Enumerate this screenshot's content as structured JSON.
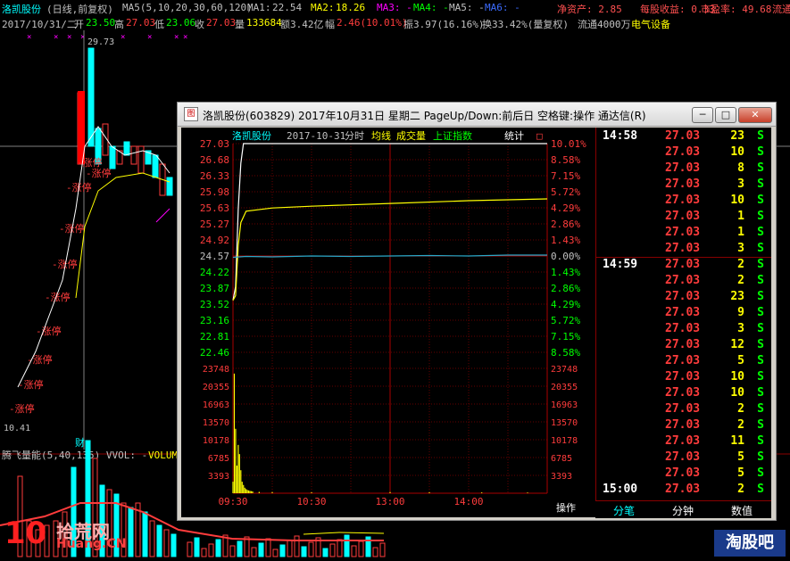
{
  "header": {
    "stock_name": "洛凯股份",
    "period": "(日线,前复权)",
    "ma_params": "MA5(5,10,20,30,60,120)",
    "ma1_label": "MA1:",
    "ma1_value": "22.54",
    "ma2_label": "MA2:",
    "ma2_value": "18.26",
    "ma3_label": "MA3: -",
    "ma4_label": "MA4: -",
    "ma5_label": "MA5: -",
    "ma6_label": "MA6: -",
    "net_asset": "净资产: 2.85",
    "eps": "每股收益: 0.33",
    "pe": "市盈率: 49.68",
    "liquidity": "流通"
  },
  "row2": {
    "date": "2017/10/31/二",
    "open_label": "开",
    "open": "23.50",
    "high_label": "高",
    "high": "27.03",
    "low_label": "低",
    "low": "23.06",
    "close_label": "收",
    "close": "27.03",
    "volume_label": "量",
    "volume": "133684",
    "amount": "额3.42亿",
    "change_label": "幅",
    "change": "2.46(10.01%)",
    "amplitude": "振3.97(16.16%)",
    "turnover": "换33.42%(量复权)",
    "float": "流通4000万",
    "industry": "电气设备"
  },
  "kline": {
    "high_marker": "29.73",
    "low_marker": "10.41",
    "limit_up_text": "涨停",
    "finance_marker": "财",
    "indicator_label": "腾飞量能(5,40,135) VVOL: -",
    "indicator_vol_label": "VOLUM"
  },
  "window": {
    "title": "洛凯股份(603829) 2017年10月31日 星期二 PageUp/Down:前后日 空格键:操作 通达信(R)",
    "btn_min": "─",
    "btn_max": "□",
    "btn_close": "✕",
    "chart_title": "洛凯股份",
    "chart_date": "2017-10-31",
    "chart_mode": "分时",
    "avg_line": "均线",
    "volume_label": "成交量",
    "index_label": "上证指数",
    "stats_label": "统计",
    "stats_box": "□",
    "ops_label": "操作",
    "tab_ticks": "分笔",
    "tab_minute": "分钟",
    "tab_value": "数值"
  },
  "chart_data": {
    "type": "line",
    "price_ticks": [
      "27.03",
      "26.68",
      "26.33",
      "25.98",
      "25.63",
      "25.27",
      "24.92",
      "24.57",
      "24.22",
      "23.87",
      "23.52",
      "23.16",
      "22.81",
      "22.46"
    ],
    "pct_ticks": [
      "10.01%",
      "8.58%",
      "7.15%",
      "5.72%",
      "4.29%",
      "2.86%",
      "1.43%",
      "0.00%",
      "1.43%",
      "2.86%",
      "4.29%",
      "5.72%",
      "7.15%",
      "8.58%"
    ],
    "vol_ticks": [
      "23748",
      "20355",
      "16963",
      "13570",
      "10178",
      "6785",
      "3393"
    ],
    "time_ticks": [
      "09:30",
      "10:30",
      "13:00",
      "14:00"
    ],
    "prev_close": 24.57,
    "ylim": [
      22.11,
      27.03
    ],
    "series": [
      {
        "name": "分时",
        "points": [
          [
            0,
            23.6
          ],
          [
            2,
            23.9
          ],
          [
            4,
            25.6
          ],
          [
            6,
            26.6
          ],
          [
            8,
            27.03
          ],
          [
            240,
            27.03
          ]
        ]
      },
      {
        "name": "均线",
        "points": [
          [
            0,
            23.6
          ],
          [
            2,
            23.7
          ],
          [
            4,
            24.8
          ],
          [
            6,
            25.3
          ],
          [
            10,
            25.55
          ],
          [
            30,
            25.62
          ],
          [
            60,
            25.66
          ],
          [
            120,
            25.72
          ],
          [
            180,
            25.78
          ],
          [
            240,
            25.82
          ]
        ]
      },
      {
        "name": "上证指数",
        "points": [
          [
            0,
            24.54
          ],
          [
            10,
            24.56
          ],
          [
            30,
            24.55
          ],
          [
            60,
            24.57
          ],
          [
            90,
            24.56
          ],
          [
            120,
            24.57
          ],
          [
            150,
            24.58
          ],
          [
            180,
            24.57
          ],
          [
            210,
            24.59
          ],
          [
            240,
            24.59
          ]
        ]
      }
    ],
    "volume_max": 27140,
    "volumes": [
      [
        0,
        2500
      ],
      [
        1,
        26000
      ],
      [
        2,
        14000
      ],
      [
        3,
        6000
      ],
      [
        4,
        10500
      ],
      [
        5,
        8500
      ],
      [
        6,
        5000
      ],
      [
        7,
        2500
      ],
      [
        8,
        1800
      ],
      [
        9,
        1200
      ],
      [
        10,
        900
      ],
      [
        11,
        700
      ],
      [
        12,
        600
      ],
      [
        13,
        500
      ],
      [
        14,
        450
      ],
      [
        15,
        400
      ],
      [
        20,
        300
      ],
      [
        30,
        250
      ],
      [
        60,
        200
      ],
      [
        120,
        250
      ],
      [
        150,
        200
      ],
      [
        190,
        180
      ],
      [
        225,
        150
      ]
    ]
  },
  "ticks": [
    {
      "time": "14:58",
      "price": "27.03",
      "vol": "23",
      "side": "S"
    },
    {
      "time": "",
      "price": "27.03",
      "vol": "10",
      "side": "S"
    },
    {
      "time": "",
      "price": "27.03",
      "vol": "8",
      "side": "S"
    },
    {
      "time": "",
      "price": "27.03",
      "vol": "3",
      "side": "S"
    },
    {
      "time": "",
      "price": "27.03",
      "vol": "10",
      "side": "S"
    },
    {
      "time": "",
      "price": "27.03",
      "vol": "1",
      "side": "S"
    },
    {
      "time": "",
      "price": "27.03",
      "vol": "1",
      "side": "S"
    },
    {
      "time": "",
      "price": "27.03",
      "vol": "3",
      "side": "S"
    },
    {
      "time": "14:59",
      "price": "27.03",
      "vol": "2",
      "side": "S"
    },
    {
      "time": "",
      "price": "27.03",
      "vol": "2",
      "side": "S"
    },
    {
      "time": "",
      "price": "27.03",
      "vol": "23",
      "side": "S"
    },
    {
      "time": "",
      "price": "27.03",
      "vol": "9",
      "side": "S"
    },
    {
      "time": "",
      "price": "27.03",
      "vol": "3",
      "side": "S"
    },
    {
      "time": "",
      "price": "27.03",
      "vol": "12",
      "side": "S"
    },
    {
      "time": "",
      "price": "27.03",
      "vol": "5",
      "side": "S"
    },
    {
      "time": "",
      "price": "27.03",
      "vol": "10",
      "side": "S"
    },
    {
      "time": "",
      "price": "27.03",
      "vol": "10",
      "side": "S"
    },
    {
      "time": "",
      "price": "27.03",
      "vol": "2",
      "side": "S"
    },
    {
      "time": "",
      "price": "27.03",
      "vol": "2",
      "side": "S"
    },
    {
      "time": "",
      "price": "27.03",
      "vol": "11",
      "side": "S"
    },
    {
      "time": "",
      "price": "27.03",
      "vol": "5",
      "side": "S"
    },
    {
      "time": "",
      "price": "27.03",
      "vol": "5",
      "side": "S"
    },
    {
      "time": "15:00",
      "price": "27.03",
      "vol": "2",
      "side": "S"
    }
  ],
  "watermark": {
    "left_logo": "10",
    "left_text": "拾荒网",
    "left_url": "Huang.CN",
    "right_text": "淘股吧"
  },
  "colors": {
    "up": "#ff3c3c",
    "down": "#00ffff",
    "grid": "#8b0000",
    "yellow": "#ffff00",
    "white": "#ffffff",
    "green": "#00ff00",
    "teal": "#2aa9c9",
    "magenta": "#ff00ff"
  }
}
